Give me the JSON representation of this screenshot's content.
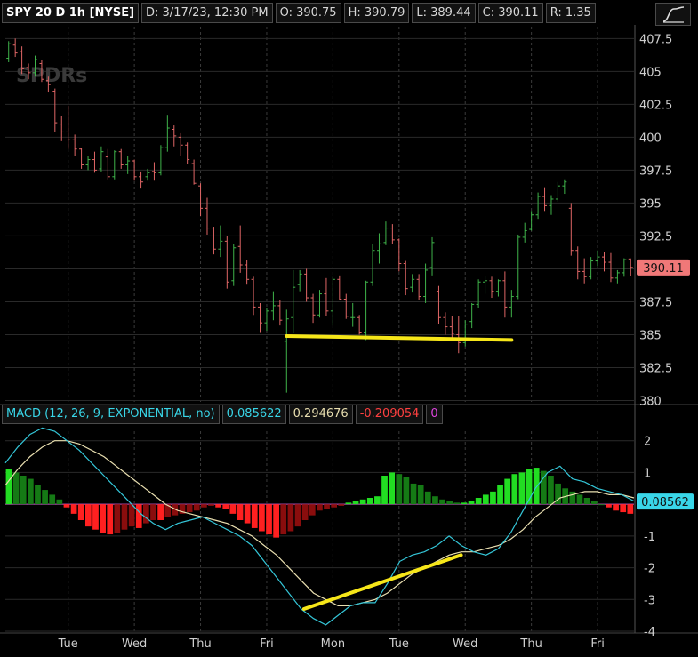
{
  "header": {
    "symbol": "SPY 20 D 1h [NYSE]",
    "date": "D: 3/17/23, 12:30 PM",
    "open": "O: 390.75",
    "high": "H: 390.79",
    "low": "L: 389.44",
    "close": "C: 390.11",
    "range": "R: 1.35",
    "watermark": "SPDRs"
  },
  "macd_header": {
    "label": "MACD (12, 26, 9, EXPONENTIAL, no)",
    "value": "0.085622",
    "avg": "0.294676",
    "diff": "-0.209054",
    "zero": "0"
  },
  "colors": {
    "up": "#3fb34a",
    "down": "#e06666",
    "macd": "#34c6d8",
    "signal": "#e9dfb0",
    "hist_up": "#22dd22",
    "hist_up_dim": "#157a15",
    "hist_down": "#ff2020",
    "hist_down_dim": "#8a0d0d",
    "trendline": "#f6e619",
    "price_tag": "#f07878",
    "macd_tag": "#39d6e8",
    "zero_line": "#cc55cc"
  },
  "chart_data": [
    {
      "type": "candlestick",
      "y_ticks": [
        "407.5",
        "405",
        "402.5",
        "400",
        "397.5",
        "395",
        "392.5",
        "390",
        "387.5",
        "385",
        "382.5",
        "380"
      ],
      "ylim": [
        379.9,
        408.4
      ],
      "last_price_tag": "390.11",
      "x_labels": [
        "Tue",
        "Wed",
        "Thu",
        "Fri",
        "Mon",
        "Tue",
        "Wed",
        "Thu",
        "Fri"
      ],
      "candles": [
        [
          406,
          407.3,
          405.7,
          407.1
        ],
        [
          407,
          407.5,
          406.1,
          406.4
        ],
        [
          406.5,
          406.9,
          404.8,
          405.2
        ],
        [
          405.3,
          405.6,
          404.4,
          404.9
        ],
        [
          404.9,
          406.2,
          404.6,
          405.9
        ],
        [
          405.6,
          405.9,
          404.2,
          404.4
        ],
        [
          404.3,
          404.6,
          403.4,
          404
        ],
        [
          403.5,
          403.7,
          400.4,
          401.1
        ],
        [
          401,
          401.6,
          399.7,
          400.4
        ],
        [
          400.4,
          402.4,
          399.1,
          399.8
        ],
        [
          399.8,
          400.2,
          398.6,
          399.1
        ],
        [
          399.1,
          399.2,
          397.6,
          397.9
        ],
        [
          397.9,
          398.6,
          397.5,
          398.3
        ],
        [
          398.3,
          398.9,
          397.3,
          397.5
        ],
        [
          397.6,
          399.3,
          397.4,
          398.9
        ],
        [
          398.5,
          399.1,
          396.8,
          397
        ],
        [
          397,
          399,
          396.8,
          398.9
        ],
        [
          398.9,
          399.1,
          397.6,
          397.9
        ],
        [
          397.9,
          398.6,
          397.2,
          398.2
        ],
        [
          398.2,
          398.3,
          396.7,
          397
        ],
        [
          397,
          397.4,
          396.1,
          396.6
        ],
        [
          397,
          397.6,
          396.7,
          397.3
        ],
        [
          397.4,
          398.1,
          396.7,
          397.3
        ],
        [
          397.3,
          399.4,
          397.1,
          399.2
        ],
        [
          399.2,
          401.7,
          398.9,
          400.7
        ],
        [
          400.6,
          400.9,
          399.3,
          400.1
        ],
        [
          400,
          400.3,
          398.6,
          399.4
        ],
        [
          399.4,
          399.6,
          398,
          398.3
        ],
        [
          398,
          398.3,
          396.4,
          396.5
        ],
        [
          396.3,
          396.5,
          394,
          394.6
        ],
        [
          394.6,
          395.4,
          392.6,
          393.1
        ],
        [
          393.1,
          393.2,
          391.1,
          391.5
        ],
        [
          391.5,
          393.3,
          390.9,
          392.1
        ],
        [
          392.1,
          392.5,
          388.5,
          389
        ],
        [
          389.1,
          391.9,
          388.7,
          391.6
        ],
        [
          391.7,
          393.3,
          389.7,
          390.3
        ],
        [
          390.3,
          390.7,
          388.8,
          389.2
        ],
        [
          389.2,
          389.4,
          386.5,
          387.1
        ],
        [
          387.1,
          387.4,
          385.2,
          385.9
        ],
        [
          385.9,
          387,
          385.3,
          386.8
        ],
        [
          386.8,
          388.3,
          386.1,
          387.2
        ],
        [
          387.2,
          387.6,
          385.7,
          386.1
        ],
        [
          384.5,
          386.9,
          380.6,
          386.2
        ],
        [
          386.3,
          389.9,
          385.1,
          388.6
        ],
        [
          388.8,
          389.9,
          388.3,
          389.6
        ],
        [
          389.6,
          390,
          387.5,
          387.8
        ],
        [
          387.8,
          388.1,
          385.9,
          386.5
        ],
        [
          386.5,
          388.4,
          386.3,
          388.1
        ],
        [
          388.1,
          389.3,
          386.4,
          386.8
        ],
        [
          386.8,
          389.4,
          385.7,
          389.2
        ],
        [
          389.2,
          389.5,
          387.6,
          387.7
        ],
        [
          387.7,
          388.1,
          386.2,
          386.4
        ],
        [
          386.3,
          387.4,
          385.6,
          386.3
        ],
        [
          386.3,
          386.5,
          385,
          385.2
        ],
        [
          385.2,
          389.1,
          384.6,
          389
        ],
        [
          389,
          391.9,
          388.7,
          391.4
        ],
        [
          391.4,
          392.7,
          390.4,
          391.9
        ],
        [
          392,
          393.6,
          391.8,
          393.1
        ],
        [
          393.1,
          393.4,
          391.9,
          392.2
        ],
        [
          392.2,
          392.3,
          389.8,
          390.4
        ],
        [
          390.4,
          390.6,
          388,
          388.5
        ],
        [
          388.6,
          389.6,
          388.2,
          389.2
        ],
        [
          389.2,
          389.6,
          387.6,
          387.9
        ],
        [
          387.9,
          390.4,
          387.4,
          389.9
        ],
        [
          390.1,
          392.4,
          389.5,
          392
        ],
        [
          388.3,
          388.7,
          385.8,
          386.3
        ],
        [
          386.3,
          386.7,
          385,
          385.6
        ],
        [
          385.6,
          386.4,
          384.5,
          385.1
        ],
        [
          385,
          386.4,
          383.6,
          384.4
        ],
        [
          384.4,
          386.1,
          384.1,
          385.8
        ],
        [
          386,
          387.4,
          385.5,
          387.3
        ],
        [
          387.3,
          389.2,
          387,
          389
        ],
        [
          389,
          389.5,
          388.1,
          389.1
        ],
        [
          389.1,
          389.4,
          387.8,
          388.3
        ],
        [
          388.3,
          389.2,
          387.9,
          389.1
        ],
        [
          389.1,
          389.8,
          386.3,
          387.1
        ],
        [
          387.1,
          388.4,
          386.3,
          387.9
        ],
        [
          387.9,
          392.6,
          387.7,
          392.4
        ],
        [
          392.4,
          393.5,
          392,
          392.9
        ],
        [
          393,
          394.4,
          392.9,
          394.1
        ],
        [
          394.1,
          395.8,
          393.8,
          395.5
        ],
        [
          395.5,
          396.2,
          394.4,
          394.8
        ],
        [
          394.8,
          395.6,
          394.1,
          395.3
        ],
        [
          395.3,
          396.6,
          395.1,
          396.3
        ],
        [
          396.3,
          396.8,
          395.7,
          396.6
        ],
        [
          394.6,
          395,
          391,
          391.4
        ],
        [
          391.4,
          391.7,
          389.2,
          389.8
        ],
        [
          389.8,
          390.8,
          388.9,
          389.4
        ],
        [
          389.4,
          390.9,
          389.2,
          390.6
        ],
        [
          390.6,
          391.4,
          390.2,
          390.9
        ],
        [
          390.9,
          391.3,
          389.8,
          390.5
        ],
        [
          390.5,
          391.2,
          389,
          389.3
        ],
        [
          389.3,
          389.9,
          388.9,
          389.7
        ],
        [
          389.7,
          390.8,
          389.4,
          390.7
        ],
        [
          390.75,
          390.79,
          389.44,
          390.11
        ]
      ],
      "trendline_price": [
        [
          42,
          384.9
        ],
        [
          76,
          384.6
        ]
      ]
    },
    {
      "type": "macd",
      "y_ticks": [
        "2",
        "1",
        "0",
        "-1",
        "-2",
        "-3",
        "-4"
      ],
      "ylim": [
        -4,
        2.3
      ],
      "last_value_tag": "0.08562",
      "macd": [
        1.3,
        1.8,
        2.2,
        2.4,
        2.3,
        2.0,
        1.7,
        1.3,
        0.9,
        0.5,
        0.1,
        -0.3,
        -0.6,
        -0.8,
        -0.6,
        -0.5,
        -0.4,
        -0.6,
        -0.8,
        -1.0,
        -1.3,
        -1.8,
        -2.3,
        -2.8,
        -3.3,
        -3.6,
        -3.8,
        -3.5,
        -3.2,
        -3.1,
        -3.1,
        -2.5,
        -1.8,
        -1.6,
        -1.5,
        -1.3,
        -1.0,
        -1.3,
        -1.5,
        -1.6,
        -1.4,
        -0.9,
        -0.2,
        0.5,
        1.0,
        1.2,
        0.8,
        0.7,
        0.5,
        0.4,
        0.3,
        0.1
      ],
      "signal": [
        0.6,
        1.1,
        1.5,
        1.8,
        2.0,
        2.0,
        1.9,
        1.7,
        1.5,
        1.2,
        0.9,
        0.6,
        0.3,
        0.0,
        -0.2,
        -0.3,
        -0.4,
        -0.5,
        -0.6,
        -0.8,
        -1.0,
        -1.3,
        -1.6,
        -2.0,
        -2.4,
        -2.8,
        -3.0,
        -3.2,
        -3.2,
        -3.1,
        -3.0,
        -2.8,
        -2.5,
        -2.2,
        -2.0,
        -1.8,
        -1.6,
        -1.5,
        -1.5,
        -1.4,
        -1.3,
        -1.1,
        -0.8,
        -0.4,
        -0.1,
        0.2,
        0.3,
        0.4,
        0.4,
        0.3,
        0.3,
        0.2
      ],
      "histogram": [
        1.1,
        1.0,
        0.9,
        0.8,
        0.6,
        0.45,
        0.3,
        0.15,
        -0.1,
        -0.3,
        -0.5,
        -0.7,
        -0.8,
        -0.9,
        -0.95,
        -0.9,
        -0.8,
        -0.7,
        -0.75,
        -0.6,
        -0.5,
        -0.5,
        -0.4,
        -0.35,
        -0.3,
        -0.25,
        -0.2,
        -0.1,
        -0.05,
        -0.1,
        -0.15,
        -0.3,
        -0.5,
        -0.6,
        -0.75,
        -0.85,
        -0.95,
        -1.05,
        -0.95,
        -0.85,
        -0.7,
        -0.5,
        -0.35,
        -0.2,
        -0.15,
        -0.1,
        -0.05,
        0.05,
        0.1,
        0.15,
        0.2,
        0.25,
        0.9,
        1.0,
        0.95,
        0.85,
        0.65,
        0.6,
        0.4,
        0.25,
        0.15,
        0.1,
        0.05,
        0.05,
        0.1,
        0.2,
        0.3,
        0.4,
        0.6,
        0.8,
        0.95,
        1.0,
        1.1,
        1.15,
        1.05,
        0.9,
        0.65,
        0.5,
        0.4,
        0.3,
        0.2,
        0.1,
        0.0,
        -0.1,
        -0.2,
        -0.25,
        -0.3
      ],
      "trendline_macd": [
        [
          0.475,
          -3.3
        ],
        [
          0.725,
          -1.6
        ]
      ]
    }
  ]
}
